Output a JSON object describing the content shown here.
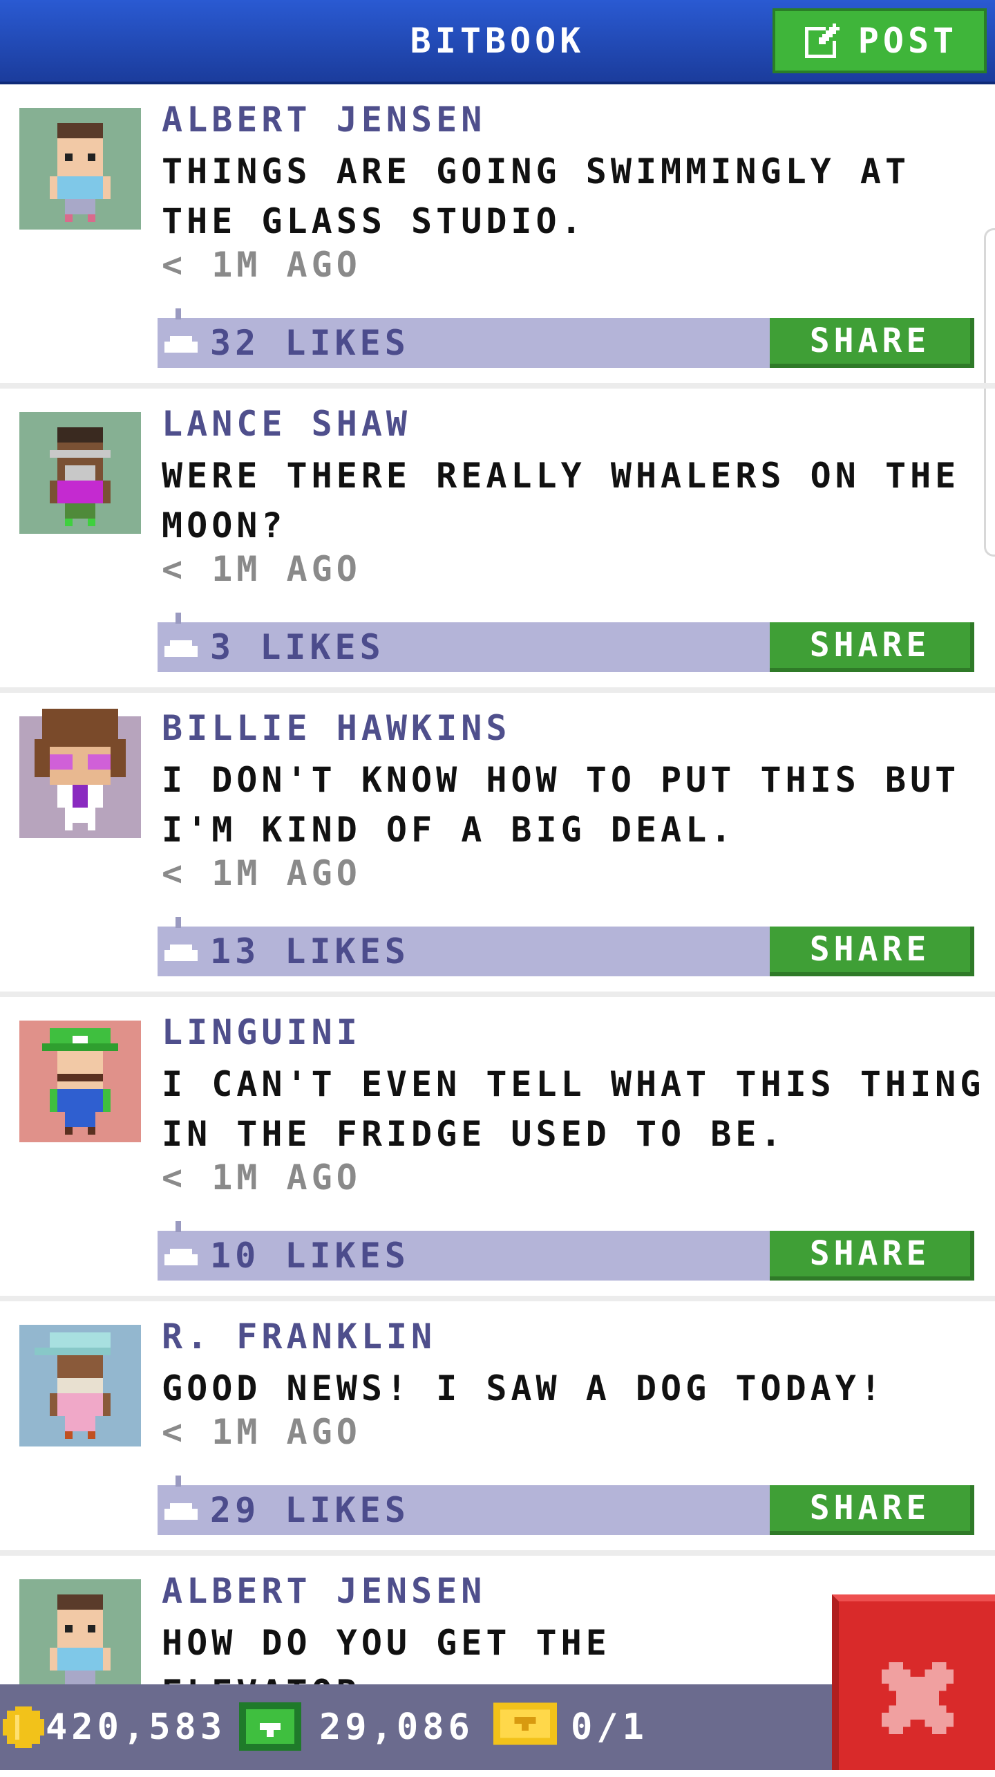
{
  "header": {
    "title": "BITBOOK",
    "post_label": "POST"
  },
  "posts": [
    {
      "author": "ALBERT JENSEN",
      "message": "THINGS ARE GOING SWIMMINGLY AT THE GLASS STUDIO.",
      "time": "< 1M AGO",
      "likes": "32 LIKES",
      "share_label": "SHARE",
      "avatar_bg": "#86b093"
    },
    {
      "author": "LANCE SHAW",
      "message": "WERE THERE REALLY WHALERS ON THE MOON?",
      "time": "< 1M AGO",
      "likes": "3 LIKES",
      "share_label": "SHARE",
      "avatar_bg": "#86b093"
    },
    {
      "author": "BILLIE HAWKINS",
      "message": "I DON'T KNOW HOW TO PUT THIS BUT I'M KIND OF A BIG DEAL.",
      "time": "< 1M AGO",
      "likes": "13 LIKES",
      "share_label": "SHARE",
      "avatar_bg": "#b7a4bd"
    },
    {
      "author": "LINGUINI",
      "message": "I CAN'T EVEN TELL WHAT THIS THING IN THE FRIDGE USED TO BE.",
      "time": "< 1M AGO",
      "likes": "10 LIKES",
      "share_label": "SHARE",
      "avatar_bg": "#e0918a"
    },
    {
      "author": "R. FRANKLIN",
      "message": "GOOD NEWS! I SAW A DOG TODAY!",
      "time": "< 1M AGO",
      "likes": "29 LIKES",
      "share_label": "SHARE",
      "avatar_bg": "#93b7cf"
    },
    {
      "author": "ALBERT JENSEN",
      "message": "HOW DO YOU GET THE ELEVATOR",
      "avatar_bg": "#86b093"
    }
  ],
  "status_bar": {
    "coins": "420,583",
    "bux": "29,086",
    "tickets": "0/1"
  },
  "icons": [
    "edit-icon",
    "like-icon",
    "coin-icon",
    "bux-icon",
    "ticket-icon",
    "close-icon"
  ],
  "colors": {
    "header": "#2452c4",
    "share": "#3f9f36",
    "likes_bar": "#b4b4d8",
    "close": "#d92a2a"
  }
}
